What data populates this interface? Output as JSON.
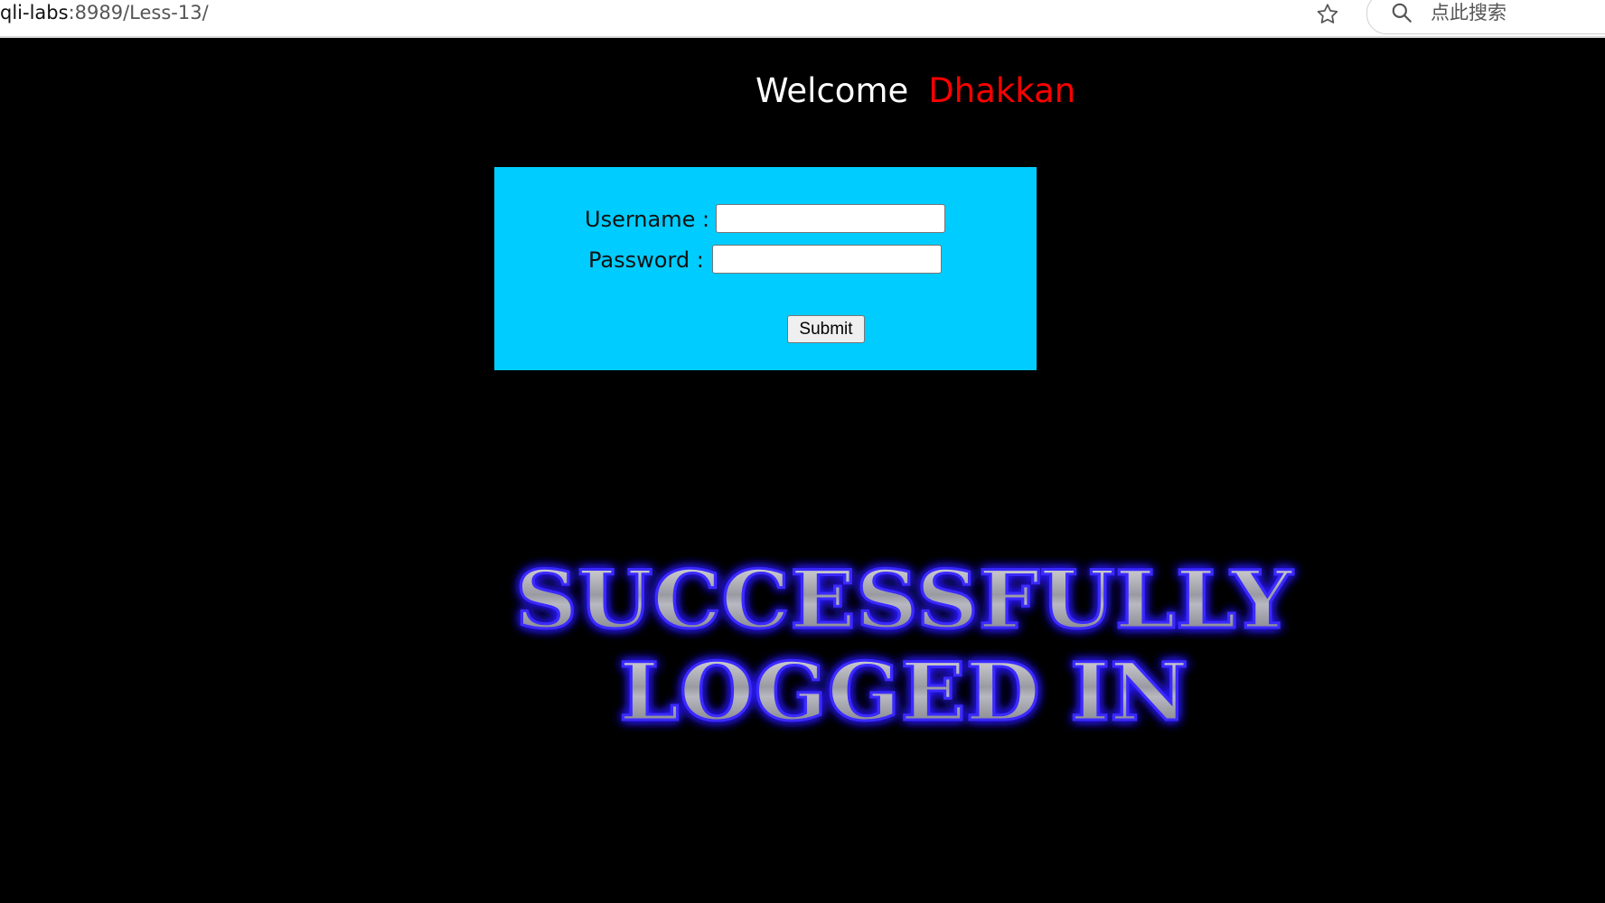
{
  "browser": {
    "url_host": "qli-labs",
    "url_rest": ":8989/Less-13/",
    "search_placeholder": "点此搜索",
    "icons": [
      "star-icon",
      "search-icon"
    ]
  },
  "header": {
    "welcome": "Welcome",
    "name": "Dhakkan",
    "name_color": "#ff0000"
  },
  "login_form": {
    "background_color": "#00ccff",
    "username_label": "Username :",
    "password_label": "Password :",
    "username_value": "",
    "password_value": "",
    "submit_label": "Submit"
  },
  "result_banner": {
    "line1": "SUCCESSFULLY",
    "line2": "LOGGED IN",
    "glow_color": "#2a1cff"
  }
}
